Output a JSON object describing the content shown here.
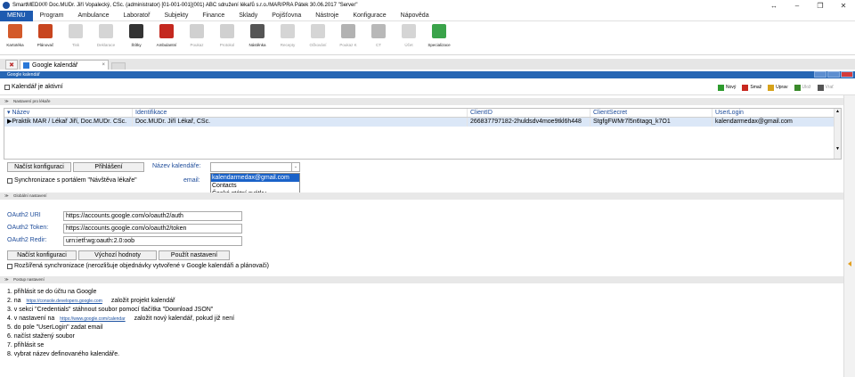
{
  "window": {
    "title": "SmartMEDIX® Doc.MUDr. Jiří Vopalecký, CSc. (administrator) [01-001-001](001) ABC sdružení lékařů s.r.o./MAR/PRA Pátek 30.06.2017 \"Server\"",
    "controls": [
      "↔",
      "–",
      "❐",
      "✕"
    ]
  },
  "menubar": {
    "menu_button": "MENU",
    "items": [
      "Program",
      "Ambulance",
      "Laboratoř",
      "Subjekty",
      "Finance",
      "Sklady",
      "Pojišťovna",
      "Nástroje",
      "Konfigurace",
      "Nápověda"
    ]
  },
  "toolbar": {
    "items": [
      {
        "label": "Kartotéka",
        "icon": "people-icon",
        "color": "#d35a2a",
        "enabled": true
      },
      {
        "label": "Plánovač",
        "icon": "calendar-icon",
        "color": "#c8451f",
        "enabled": true
      },
      {
        "label": "Tisk",
        "icon": "printer-icon",
        "color": "#888888",
        "enabled": false
      },
      {
        "label": "Deklarace",
        "icon": "scanner-icon",
        "color": "#888888",
        "enabled": false
      },
      {
        "label": "Štítky",
        "icon": "barcode-icon",
        "color": "#333333",
        "enabled": true
      },
      {
        "label": "Ambulantní",
        "icon": "acrobat-icon",
        "color": "#c4281f",
        "enabled": true
      },
      {
        "label": "Poukaz",
        "icon": "form-icon",
        "color": "#777777",
        "enabled": false
      },
      {
        "label": "Protokol",
        "icon": "clipboard-icon",
        "color": "#777777",
        "enabled": false
      },
      {
        "label": "Nástěnka",
        "icon": "notes-icon",
        "color": "#555555",
        "enabled": true
      },
      {
        "label": "Recepty",
        "icon": "pills-icon",
        "color": "#888888",
        "enabled": false
      },
      {
        "label": "Očkování",
        "icon": "syringe-icon",
        "color": "#888888",
        "enabled": false
      },
      {
        "label": "Poukaz K",
        "icon": "k-letter-icon",
        "color": "#222222",
        "enabled": false
      },
      {
        "label": "CT",
        "icon": "ct-icon",
        "color": "#333333",
        "enabled": false
      },
      {
        "label": "Účet",
        "icon": "tag-icon",
        "color": "#888888",
        "enabled": false
      },
      {
        "label": "Specializace",
        "icon": "puzzle-icon",
        "color": "#3aa34a",
        "enabled": true
      }
    ]
  },
  "tabs": {
    "active_label": "Google kalendář",
    "close_glyph": "×"
  },
  "panel": {
    "title": "Google kalendář"
  },
  "actionbar": {
    "active_checkbox_label": "Kalendář je aktivní",
    "actions": [
      {
        "label": "Nový",
        "icon": "plus-icon",
        "color": "#2e9b2e",
        "enabled": true
      },
      {
        "label": "Smaž",
        "icon": "minus-icon",
        "color": "#c8281f",
        "enabled": true
      },
      {
        "label": "Uprav",
        "icon": "pencil-icon",
        "color": "#d6a21a",
        "enabled": true
      },
      {
        "label": "Ulož",
        "icon": "check-icon",
        "color": "#3a8a2a",
        "enabled": false
      },
      {
        "label": "Vrať",
        "icon": "x-icon",
        "color": "#555555",
        "enabled": false
      }
    ]
  },
  "sections": {
    "user_settings": "Nastavení pro lékaře",
    "global_settings": "Globální nastavení",
    "procedure": "Postup nastavení"
  },
  "grid": {
    "columns": [
      "Název",
      "Identifikace",
      "ClientID",
      "ClientSecret",
      "UserLogin"
    ],
    "rows": [
      [
        "Praktik MAR / Lékař Jiří, Doc.MUDr. CSc.",
        "Doc.MUDr. Jiří Lékař, CSc.",
        "266837797182-2huldsdv4moe9tkl6h448",
        "StgfgFWMr7l5n6tagq_k7O1",
        "kalendarmedax@gmail.com"
      ]
    ]
  },
  "config": {
    "load_button": "Načíst konfiguraci",
    "login_button": "Přihlášení",
    "calendar_name_label": "Název kalendáře:",
    "calendar_options": [
      "kalendarmedax@gmail.com",
      "Contacts",
      "České státní svátky"
    ],
    "sync_label": "Synchronizace s portálem \"Návštěva lékaře\"",
    "email_label": "email:"
  },
  "oauth": {
    "uri_label": "OAuth2 URI",
    "uri_value": "https://accounts.google.com/o/oauth2/auth",
    "token_label": "OAuth2 Token:",
    "token_value": "https://accounts.google.com/o/oauth2/token",
    "redir_label": "OAuth2 Redir:",
    "redir_value": "urn:ietf:wg:oauth:2.0:oob",
    "load_button": "Načíst konfiguraci",
    "defaults_button": "Výchozí hodnoty",
    "apply_button": "Použít nastavení",
    "extended_sync_label": "Rozšířená synchronizace (nerozlišuje objednávky vytvořené v Google kalendáři a plánovači)"
  },
  "steps": {
    "s1": "1. přihlásit se do účtu na Google",
    "s2_prefix": "2. na",
    "s2_link": "https://console.developers.google.com",
    "s2_suffix": "založit projekt kalendář",
    "s3": "3. v sekci \"Credentials\" stáhnout soubor pomocí tlačítka \"Download JSON\"",
    "s4_prefix": "4. v nastavení na",
    "s4_link": "https://www.google.com/calendar",
    "s4_suffix": "založit nový kalendář, pokud již není",
    "s5": "5. do pole \"UserLogin\" zadat email",
    "s6": "6. načíst stažený soubor",
    "s7": "7. přihlásit se",
    "s8": "8. vybrat název definovaného kalendáře."
  }
}
